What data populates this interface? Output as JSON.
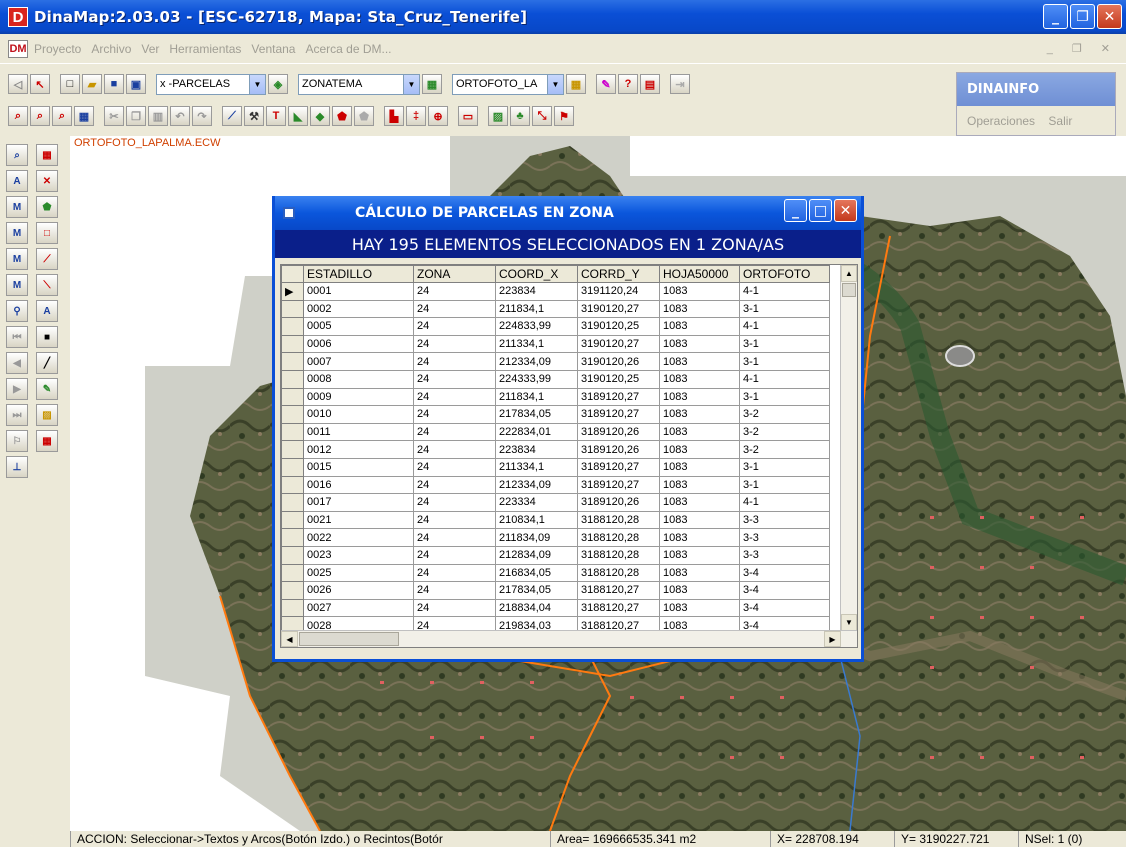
{
  "window": {
    "title": "DinaMap:2.03.03 - [ESC-62718, Mapa: Sta_Cruz_Tenerife]",
    "logo": "D"
  },
  "menubar": {
    "logo": "DM",
    "items": [
      "Proyecto",
      "Archivo",
      "Ver",
      "Herramientas",
      "Ventana",
      "Acerca de DM..."
    ]
  },
  "toolbar": {
    "combo1": "x -PARCELAS",
    "combo2": "ZONATEMA",
    "combo3": "ORTOFOTO_LA"
  },
  "dinainfo": {
    "title": "DINAINFO",
    "menu": [
      "Operaciones",
      "Salir"
    ]
  },
  "map": {
    "layer_label": "ORTOFOTO_LAPALMA.ECW"
  },
  "dialog": {
    "title": "CÁLCULO DE PARCELAS EN ZONA",
    "header": "HAY 195 ELEMENTOS SELECCIONADOS EN 1 ZONA/AS",
    "columns": [
      "ESTADILLO",
      "ZONA",
      "COORD_X",
      "CORRD_Y",
      "HOJA50000",
      "ORTOFOTO"
    ],
    "rows": [
      [
        "0001",
        "24",
        "223834",
        "3191120,24",
        "1083",
        "4-1"
      ],
      [
        "0002",
        "24",
        "211834,1",
        "3190120,27",
        "1083",
        "3-1"
      ],
      [
        "0005",
        "24",
        "224833,99",
        "3190120,25",
        "1083",
        "4-1"
      ],
      [
        "0006",
        "24",
        "211334,1",
        "3190120,27",
        "1083",
        "3-1"
      ],
      [
        "0007",
        "24",
        "212334,09",
        "3190120,26",
        "1083",
        "3-1"
      ],
      [
        "0008",
        "24",
        "224333,99",
        "3190120,25",
        "1083",
        "4-1"
      ],
      [
        "0009",
        "24",
        "211834,1",
        "3189120,27",
        "1083",
        "3-1"
      ],
      [
        "0010",
        "24",
        "217834,05",
        "3189120,27",
        "1083",
        "3-2"
      ],
      [
        "0011",
        "24",
        "222834,01",
        "3189120,26",
        "1083",
        "3-2"
      ],
      [
        "0012",
        "24",
        "223834",
        "3189120,26",
        "1083",
        "3-2"
      ],
      [
        "0015",
        "24",
        "211334,1",
        "3189120,27",
        "1083",
        "3-1"
      ],
      [
        "0016",
        "24",
        "212334,09",
        "3189120,27",
        "1083",
        "3-1"
      ],
      [
        "0017",
        "24",
        "223334",
        "3189120,26",
        "1083",
        "4-1"
      ],
      [
        "0021",
        "24",
        "210834,1",
        "3188120,28",
        "1083",
        "3-3"
      ],
      [
        "0022",
        "24",
        "211834,09",
        "3188120,28",
        "1083",
        "3-3"
      ],
      [
        "0023",
        "24",
        "212834,09",
        "3188120,28",
        "1083",
        "3-3"
      ],
      [
        "0025",
        "24",
        "216834,05",
        "3188120,28",
        "1083",
        "3-4"
      ],
      [
        "0026",
        "24",
        "217834,05",
        "3188120,27",
        "1083",
        "3-4"
      ],
      [
        "0027",
        "24",
        "218834,04",
        "3188120,27",
        "1083",
        "3-4"
      ],
      [
        "0028",
        "24",
        "219834,03",
        "3188120,27",
        "1083",
        "3-4"
      ]
    ]
  },
  "statusbar": {
    "action": "ACCION: Seleccionar->Textos y Arcos(Botón Izdo.) o Recintos(Botór",
    "area": "Area= 169666535.341 m2",
    "x": "X= 228708.194",
    "y": "Y= 3190227.721",
    "nsel": "NSel: 1 (0)"
  }
}
